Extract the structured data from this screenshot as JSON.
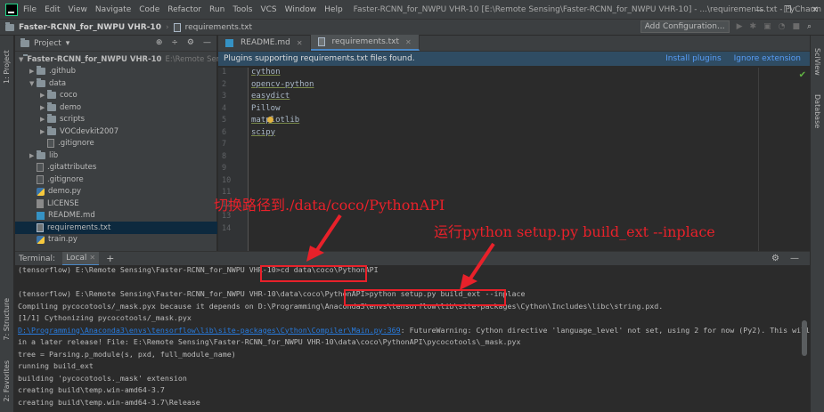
{
  "titlebar": {
    "menu": [
      "File",
      "Edit",
      "View",
      "Navigate",
      "Code",
      "Refactor",
      "Run",
      "Tools",
      "VCS",
      "Window",
      "Help"
    ],
    "window_title": "Faster-RCNN_for_NWPU VHR-10 [E:\\Remote Sensing\\Faster-RCNN_for_NWPU VHR-10] - ...\\requirements.txt - PyCharm",
    "min": "—",
    "max": "❐",
    "close": "✕"
  },
  "navbar": {
    "project": "Faster-RCNN_for_NWPU VHR-10",
    "file": "requirements.txt",
    "add_config": "Add Configuration..."
  },
  "strips": {
    "left_top": "1: Project",
    "left_structure": "7: Structure",
    "left_favorites": "2: Favorites",
    "right_sciview": "SciView",
    "right_database": "Database"
  },
  "project": {
    "title": "Project",
    "tree": [
      {
        "label": "Faster-RCNN_for_NWPU VHR-10",
        "extra": "E:\\Remote Sensing",
        "type": "folder",
        "indent": 0,
        "open": true
      },
      {
        "label": ".github",
        "type": "folder",
        "indent": 1,
        "open": false
      },
      {
        "label": "data",
        "type": "folder",
        "indent": 1,
        "open": true
      },
      {
        "label": "coco",
        "type": "folder",
        "indent": 2,
        "open": false
      },
      {
        "label": "demo",
        "type": "folder",
        "indent": 2,
        "open": false
      },
      {
        "label": "scripts",
        "type": "folder",
        "indent": 2,
        "open": false
      },
      {
        "label": "VOCdevkit2007",
        "type": "folder",
        "indent": 2,
        "open": false
      },
      {
        "label": ".gitignore",
        "type": "git",
        "indent": 2
      },
      {
        "label": "lib",
        "type": "folder",
        "indent": 1,
        "open": false
      },
      {
        "label": ".gitattributes",
        "type": "git",
        "indent": 1
      },
      {
        "label": ".gitignore",
        "type": "git",
        "indent": 1
      },
      {
        "label": "demo.py",
        "type": "py",
        "indent": 1
      },
      {
        "label": "LICENSE",
        "type": "lic",
        "indent": 1
      },
      {
        "label": "README.md",
        "type": "md",
        "indent": 1
      },
      {
        "label": "requirements.txt",
        "type": "txt",
        "indent": 1,
        "selected": true
      },
      {
        "label": "train.py",
        "type": "py",
        "indent": 1
      }
    ]
  },
  "editor": {
    "tabs": [
      {
        "label": "README.md",
        "active": false
      },
      {
        "label": "requirements.txt",
        "active": true
      }
    ],
    "banner": "Plugins supporting requirements.txt files found.",
    "banner_install": "Install plugins",
    "banner_ignore": "Ignore extension",
    "lines": [
      "cython",
      "opencv-python",
      "easydict",
      "Pillow",
      "matplotlib",
      "scipy",
      "",
      "",
      "",
      "",
      "",
      "",
      "",
      ""
    ],
    "line_numbers": [
      "1",
      "2",
      "3",
      "4",
      "5",
      "6",
      "7",
      "8",
      "9",
      "10",
      "11",
      "12",
      "13",
      "14"
    ]
  },
  "annotations": {
    "top": "切换路径到./data/coco/PythonAPI",
    "bottom": "运行python setup.py build_ext --inplace",
    "color": "#e8212a"
  },
  "terminal": {
    "label": "Terminal:",
    "tab": "Local",
    "add": "+",
    "lines": [
      {
        "text": "(tensorflow) E:\\Remote Sensing\\Faster-RCNN_for_NWPU VHR-10>cd data\\coco\\PythonAPI"
      },
      {
        "text": ""
      },
      {
        "text": "(tensorflow) E:\\Remote Sensing\\Faster-RCNN_for_NWPU VHR-10\\data\\coco\\PythonAPI>python setup.py build_ext --inplace"
      },
      {
        "text": "Compiling pycocotools/_mask.pyx because it depends on D:\\Programming\\Anaconda3\\envs\\tensorflow\\lib\\site-packages\\Cython\\Includes\\libc\\string.pxd."
      },
      {
        "text": "[1/1] Cythonizing pycocotools/_mask.pyx"
      },
      {
        "link": "D:\\Programming\\Anaconda3\\envs\\tensorflow\\lib\\site-packages\\Cython\\Compiler\\Main.py:369",
        "text": ": FutureWarning: Cython directive 'language_level' not set, using 2 for now (Py2). This will change"
      },
      {
        "text": "in a later release! File: E:\\Remote Sensing\\Faster-RCNN_for_NWPU VHR-10\\data\\coco\\PythonAPI\\pycocotools\\_mask.pyx"
      },
      {
        "text": "  tree = Parsing.p_module(s, pxd, full_module_name)"
      },
      {
        "text": "running build_ext"
      },
      {
        "text": "building 'pycocotools._mask' extension"
      },
      {
        "text": "creating build\\temp.win-amd64-3.7"
      },
      {
        "text": "creating build\\temp.win-amd64-3.7\\Release"
      }
    ]
  },
  "colors": {
    "ide_bg": "#2b2b2b",
    "panel_bg": "#3c3f41",
    "selection": "#0d293e",
    "link": "#287bde"
  }
}
